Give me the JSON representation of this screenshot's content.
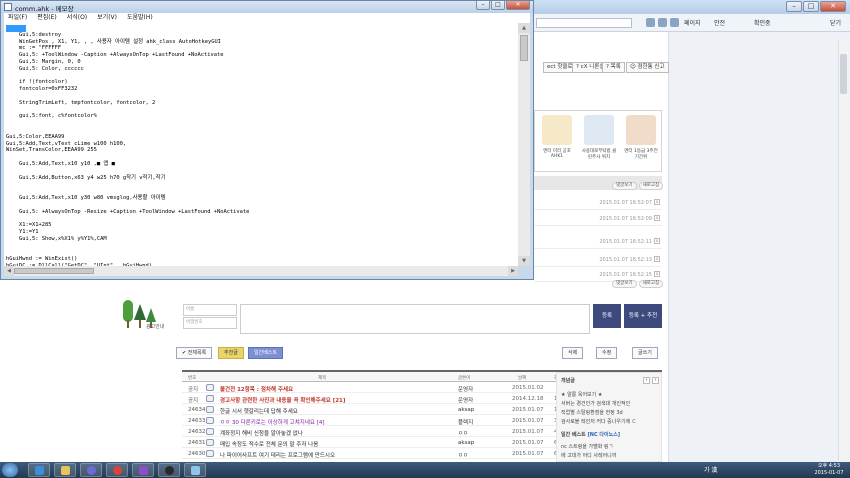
{
  "notepad": {
    "title": "comm.ahk - 메모장",
    "menus": [
      "파일(F)",
      "편집(E)",
      "서식(O)",
      "보기(V)",
      "도움말(H)"
    ],
    "content": "\n    Gui,5:destroy\n    WinGetPos , X1, Y1, , , 사용자 아이템 설정 ahk_class AutoHotkeyGUI\n    mc := \"FFFFFF\n    Gui,5: +ToolWindow -Caption +AlwaysOnTop +LastFound +NoActivate\n    Gui,5: Margin, 0, 0\n    Gui,5: Color, cccccc\n\n    if !(fontcolor)\n    fontcolor=0xFF3232\n\n    StringTrimLeft, tmpfontcolor, fontcolor, 2\n\n    gui,5:font, c%fontcolor%\n\n\nGui,5:Color,EEAA99\nGui,5:Add,Text,vText cLime w100 h100,\nWinSet,TransColor,EEAA99 255\n\n    Gui,5:Add,Text,x10 y10 ,■ 앱 ■\n\n    Gui,5:Add,Button,x63 y4 w25 h70 g작기 v작기,작기\n\n\n    Gui,5:Add,Text,x10 y30 w80 vmsglog,사용할 아이템\n\n    Gui,5: +AlwaysOnTop -Resize +Caption +ToolWindow +LastFound +NoActivate\n\n    X1:=X1+285\n    Y1:=Y1\n    Gui,5: Show,x%X1% y%Y1%,CAM\n\n\nhGuiHwnd := WinExist()\nhGuiDC := DllCall(\"GetDC\", \"UInt\",  hGuiHwnd)\n\nGosub DrawOnGui\ntestlloop=1\nreturn"
  },
  "browser": {
    "toolbar": {
      "page": "페이지",
      "safety": "안전",
      "tools": "도구",
      "help": "확인중",
      "close_label": "닫기"
    },
    "top_buttons": [
      "ect 핫클로",
      "? cX 니론설",
      "? 목록",
      "☺ 점한통 신고"
    ],
    "books": [
      {
        "caption": "엔터 미러 공포 AHK1",
        "color": "#f5e9c8"
      },
      {
        "caption": "사용대로부탁법 클린주사 위치",
        "color": "#dde8f2"
      },
      {
        "caption": "엔터 1등급 3주전 기간위",
        "color": "#f0dcc8"
      }
    ],
    "comment_tabs": [
      "댓글보기",
      "새로고침"
    ],
    "comment_times": [
      "2015.01.07 16:52:07",
      "2015.01.07 16:52:09",
      "2015.01.07 16:52:11",
      "2015.01.07 16:52:13",
      "2015.01.07 16:52:15"
    ],
    "ad_label": "광고안내",
    "comment_form": {
      "name_placeholder": "이름",
      "password_placeholder": "비밀번호",
      "submit": "등록",
      "submit_rec": "등록 + 추천"
    },
    "actions": {
      "all_list": "✔ 전체목록",
      "recommend": "추천글",
      "best": "일간베스트",
      "delete": "삭제",
      "edit": "수정",
      "write": "글쓰기"
    },
    "board": {
      "columns": [
        "번호",
        "제목",
        "글쓴이",
        "날짜",
        "조회",
        "추천"
      ],
      "rows": [
        {
          "no": "공지",
          "title": "불건전 12항목 : 점차해 주세요",
          "author": "운영자",
          "date": "2015.01.02",
          "views": "",
          "rec": "",
          "color": "#c0392b"
        },
        {
          "no": "공지",
          "title": "경고사항 관련한 사진과 내용을 꼭 확인해주세요 [21]",
          "author": "운영자",
          "date": "2014.12.18",
          "views": "1225",
          "rec": "0",
          "color": "#c0392b"
        },
        {
          "no": "24634",
          "title": "한글 시서 헷갈리는데 답해 주세요",
          "author": "aksap",
          "date": "2015.01.07",
          "views": "1",
          "rec": "0",
          "color": "#222"
        },
        {
          "no": "24633",
          "title": "ㅇㅇ 30 다른키로는 이상하게 고쳐지네요 [4]",
          "author": "플렉지",
          "date": "2015.01.07",
          "views": "30",
          "rec": "0",
          "color": "#7b1fa2"
        },
        {
          "no": "24632",
          "title": "계좌정지 해비 신청을 알아놓겠 없나",
          "author": "ㅇㅇ",
          "date": "2015.01.07",
          "views": "4",
          "rec": "0",
          "color": "#222"
        },
        {
          "no": "24631",
          "title": "매입 속정도 적수로 전체 문의 말 주저 나옴",
          "author": "aksap",
          "date": "2015.01.07",
          "views": "6",
          "rec": "0",
          "color": "#222"
        },
        {
          "no": "24630",
          "title": "나 파이어사프트 여기 데리는 프로그램에 만드시오",
          "author": "ㅇㅇ",
          "date": "2015.01.07",
          "views": "6",
          "rec": "0",
          "color": "#222"
        }
      ]
    },
    "side_box": {
      "title": "개념글",
      "items": [
        "★ 알릉 옥어보기 ★",
        "서버는 경건인가 검색대 개인적인",
        "직업별 스탈링환점을 한정 3d",
        "검사로블 레인저 커다 중나우기에 ㄷ"
      ],
      "best_title": "일간 베스트",
      "best_tag": "[NC 다이노스]",
      "best_items": [
        "nc 스트링을 가벨화 링ㄱ",
        "에 고대가 어디 사레어니까"
      ]
    }
  },
  "taskbar": {
    "ime": "가 漢",
    "time": "오후 4:53",
    "date": "2015-01-07"
  },
  "colors": {
    "accent": "#3e4a7d",
    "selection": "#3399ff"
  }
}
